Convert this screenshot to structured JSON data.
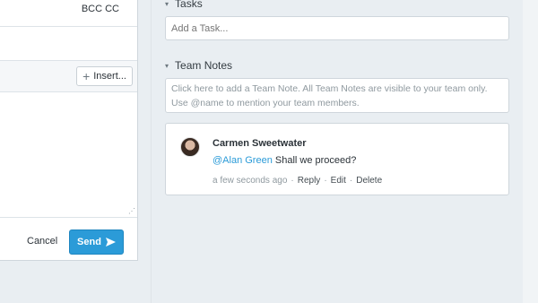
{
  "compose": {
    "bcc_cc_label": "BCC CC",
    "insert_label": "Insert...",
    "cancel_label": "Cancel",
    "send_label": "Send"
  },
  "tasks": {
    "title": "Tasks",
    "placeholder": "Add a Task..."
  },
  "team_notes": {
    "title": "Team Notes",
    "placeholder": "Click here to add a Team Note. All Team Notes are visible to your team only. Use @name to mention your team members.",
    "note": {
      "author": "Carmen Sweetwater",
      "mention": "@Alan Green",
      "text": " Shall we proceed?",
      "time": "a few seconds ago",
      "sep": "·",
      "reply": "Reply",
      "edit": "Edit",
      "delete": "Delete"
    }
  },
  "icons": {
    "plus": "plus-icon",
    "send": "paper-plane-icon",
    "chevron": "chevron-down-icon",
    "grip": "resize-grip-icon"
  },
  "colors": {
    "accent": "#2b9bd8",
    "background": "#e9eef2"
  }
}
